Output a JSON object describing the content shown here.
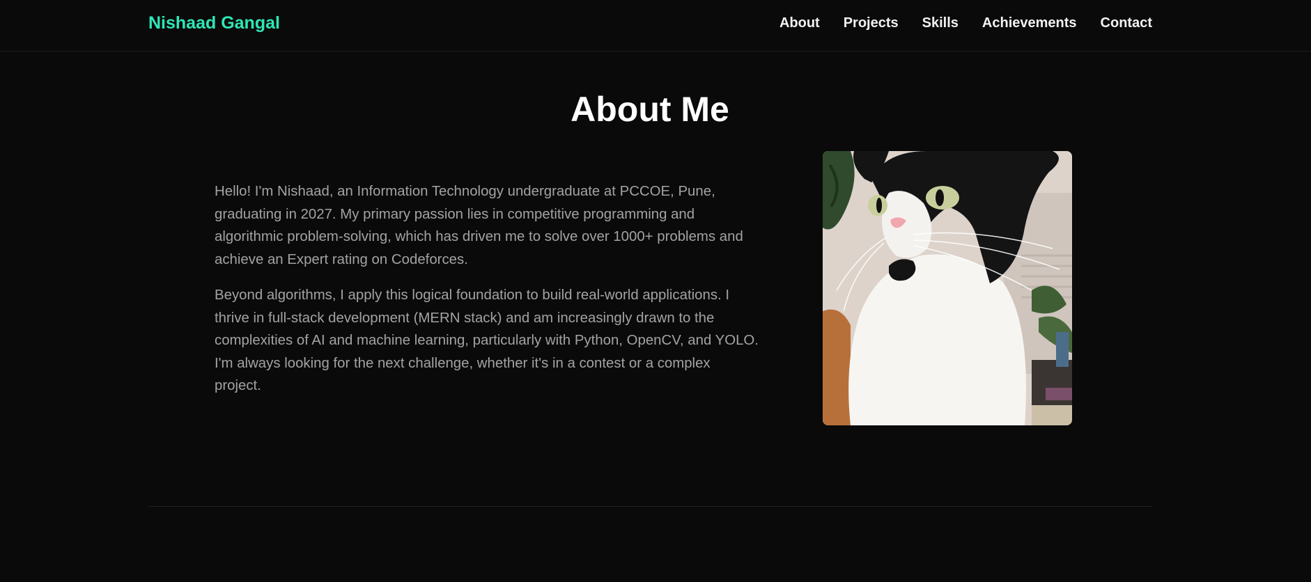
{
  "nav": {
    "brand": "Nishaad Gangal",
    "links": [
      "About",
      "Projects",
      "Skills",
      "Achievements",
      "Contact"
    ]
  },
  "about": {
    "title": "About Me",
    "paragraphs": [
      "Hello! I'm Nishaad, an Information Technology undergraduate at PCCOE, Pune, graduating in 2027. My primary passion lies in competitive programming and algorithmic problem-solving, which has driven me to solve over 1000+ problems and achieve an Expert rating on Codeforces.",
      "Beyond algorithms, I apply this logical foundation to build real-world applications. I thrive in full-stack development (MERN stack) and am increasingly drawn to the complexities of AI and machine learning, particularly with Python, OpenCV, and YOLO. I'm always looking for the next challenge, whether it's in a contest or a complex project."
    ]
  },
  "colors": {
    "background": "#0a0a0a",
    "accent": "#2ee6b6",
    "body_text": "#a3a3a3"
  }
}
